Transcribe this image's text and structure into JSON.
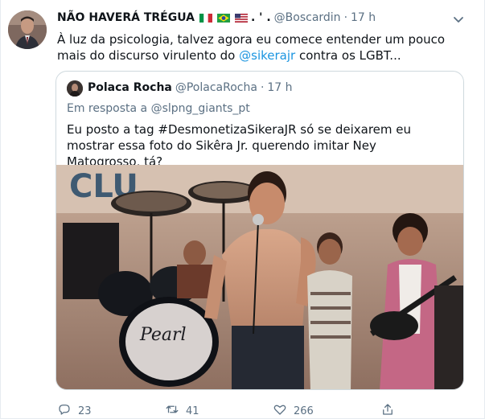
{
  "tweet": {
    "author_name": "NÃO HAVERÁ TRÉGUA",
    "flag_suffix": ". ' .",
    "handle": "@Boscardin",
    "separator": "·",
    "time": "17 h",
    "text_before": "À luz da psicologia, talvez agora eu comece entender um pouco mais do discurso virulento do ",
    "mention": "@sikerajr",
    "text_after": " contra os LGBT..."
  },
  "quoted": {
    "author_name": "Polaca Rocha",
    "handle": "@PolacaRocha",
    "separator": "·",
    "time": "17 h",
    "replying_to": "Em resposta a @slpng_giants_pt",
    "text": "Eu posto a tag #DesmonetizaSikeraJR só se deixarem eu mostrar essa foto do Sikêra Jr. querendo imitar Ney Matogrosso, tá?",
    "photo_sign_text": "CLU"
  },
  "actions": {
    "reply_count": "23",
    "retweet_count": "41",
    "like_count": "266"
  },
  "icons": {
    "more": "more-icon",
    "reply": "reply-icon",
    "retweet": "retweet-icon",
    "like": "heart-icon",
    "share": "share-icon"
  },
  "colors": {
    "link": "#1b95e0",
    "secondary": "#5b7083",
    "border": "#cfd9de"
  }
}
